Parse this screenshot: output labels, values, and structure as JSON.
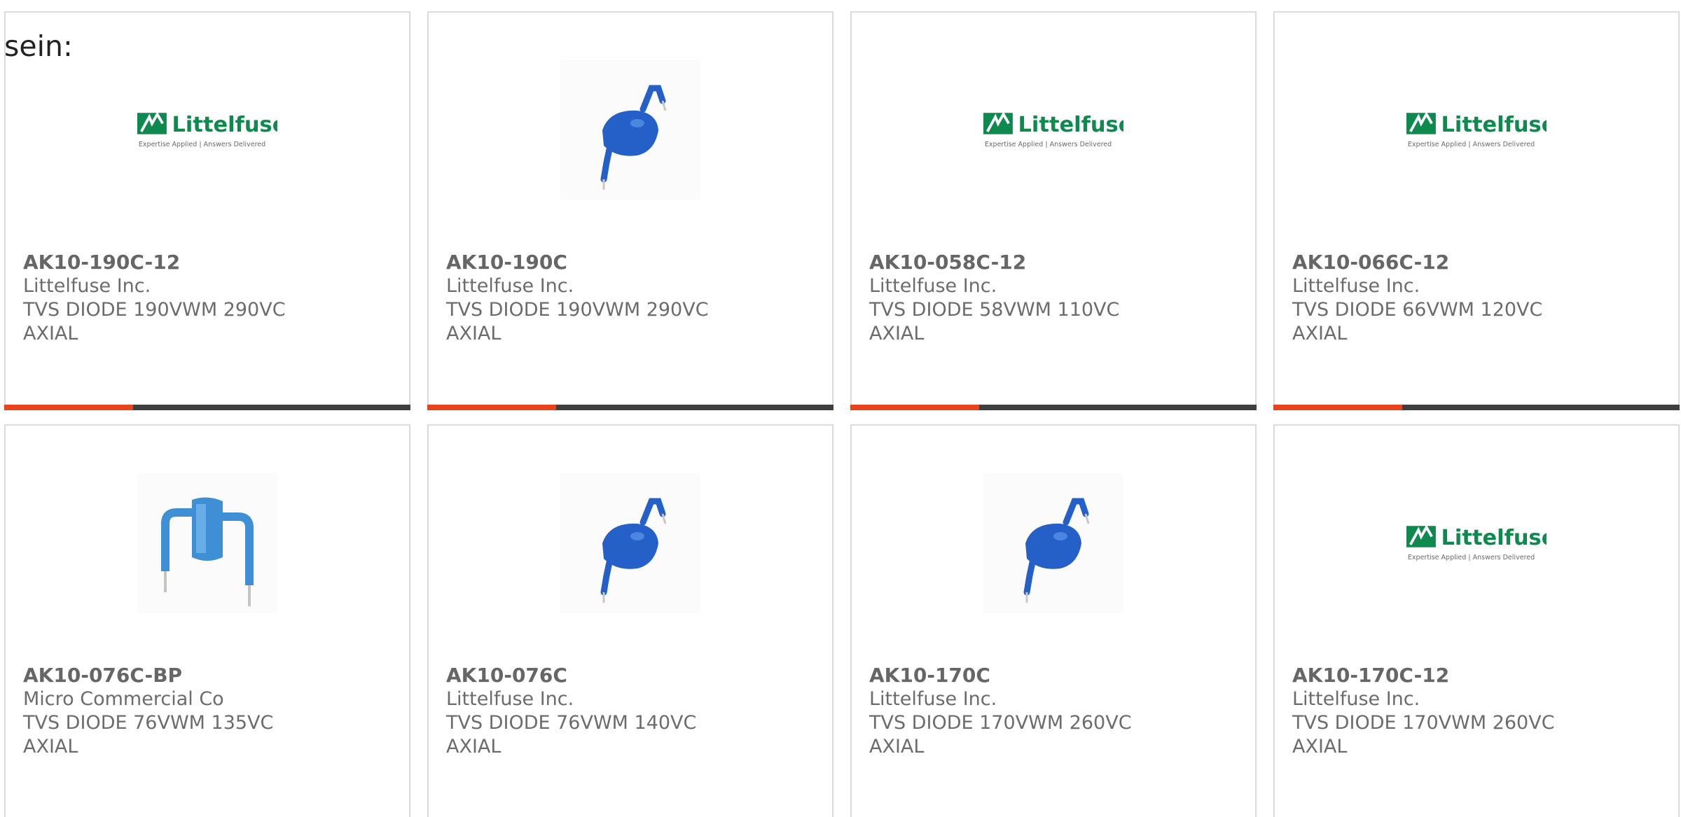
{
  "intro_text": "sein:",
  "colors": {
    "accent": "#e8441c",
    "bar": "#3f3f3f",
    "brand_green": "#0f8a4e",
    "diode_blue": "#2460c8",
    "diode_light_blue": "#3f8fd6"
  },
  "products": [
    {
      "part_number": "AK10-190C-12",
      "manufacturer": "Littelfuse Inc.",
      "description": "TVS DIODE 190VWM 290VC AXIAL",
      "image": "littelfuse-logo"
    },
    {
      "part_number": "AK10-190C",
      "manufacturer": "Littelfuse Inc.",
      "description": "TVS DIODE 190VWM 290VC AXIAL",
      "image": "blue-axial-diode"
    },
    {
      "part_number": "AK10-058C-12",
      "manufacturer": "Littelfuse Inc.",
      "description": "TVS DIODE 58VWM 110VC AXIAL",
      "image": "littelfuse-logo"
    },
    {
      "part_number": "AK10-066C-12",
      "manufacturer": "Littelfuse Inc.",
      "description": "TVS DIODE 66VWM 120VC AXIAL",
      "image": "littelfuse-logo"
    },
    {
      "part_number": "AK10-076C-BP",
      "manufacturer": "Micro Commercial Co",
      "description": "TVS DIODE 76VWM 135VC AXIAL",
      "image": "blue-bent-diode"
    },
    {
      "part_number": "AK10-076C",
      "manufacturer": "Littelfuse Inc.",
      "description": "TVS DIODE 76VWM 140VC AXIAL",
      "image": "blue-axial-diode"
    },
    {
      "part_number": "AK10-170C",
      "manufacturer": "Littelfuse Inc.",
      "description": "TVS DIODE 170VWM 260VC AXIAL",
      "image": "blue-axial-diode"
    },
    {
      "part_number": "AK10-170C-12",
      "manufacturer": "Littelfuse Inc.",
      "description": "TVS DIODE 170VWM 260VC AXIAL",
      "image": "littelfuse-logo"
    }
  ],
  "logo": {
    "brand": "Littelfuse",
    "tagline": "Expertise Applied | Answers Delivered"
  }
}
